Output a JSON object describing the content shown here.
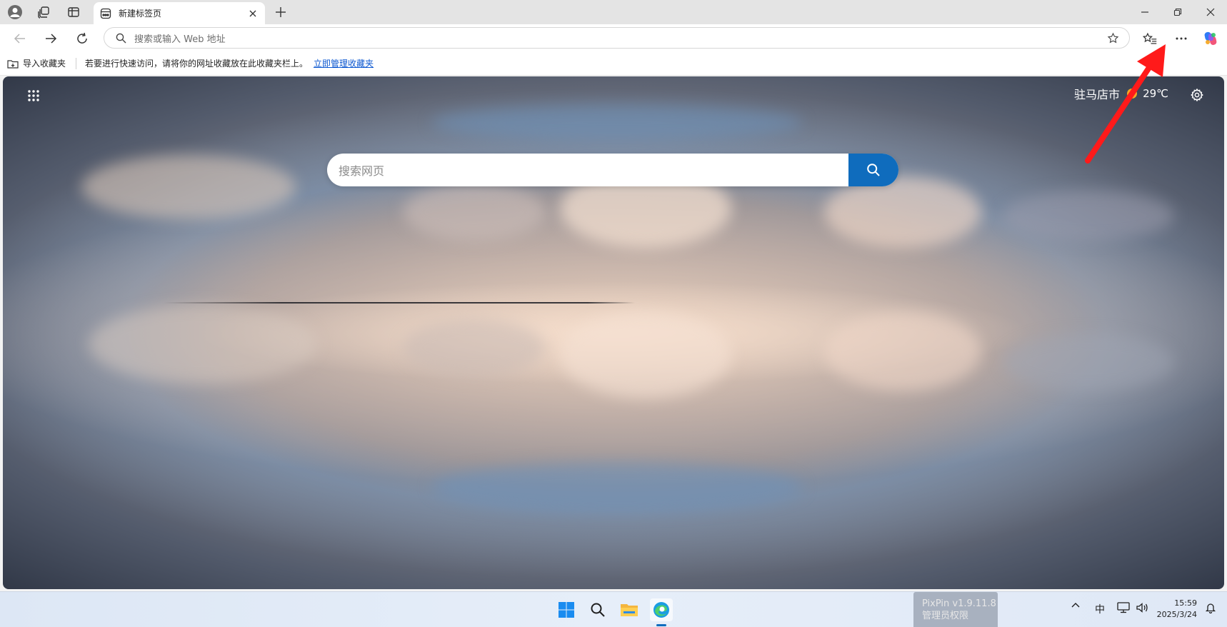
{
  "tabbar": {
    "active_tab_title": "新建标签页",
    "icons": [
      "profile-icon",
      "collections-icon",
      "vertical-tabs-icon",
      "close-icon",
      "plus-icon",
      "minimize-icon",
      "restore-icon",
      "window-close-icon"
    ]
  },
  "navbar": {
    "address_placeholder": "搜索或输入 Web 地址",
    "icons": [
      "back-icon",
      "forward-icon",
      "refresh-icon",
      "search-icon",
      "star-icon",
      "favorites-icon",
      "more-icon",
      "copilot-icon"
    ]
  },
  "favbar": {
    "import_label": "导入收藏夹",
    "hint": "若要进行快速访问，请将你的网址收藏放在此收藏夹栏上。",
    "manage_link": "立即管理收藏夹"
  },
  "newtab": {
    "weather_city": "驻马店市",
    "weather_temp": "29℃",
    "search_placeholder": "搜索网页"
  },
  "taskbar": {
    "overlay_line1": "PixPin v1.9.11.8",
    "overlay_line2": "管理员权限",
    "ime": "中",
    "time": "15:59",
    "date": "2025/3/24"
  },
  "colors": {
    "accent": "#0f6cbd",
    "annotation_arrow": "#ff1a1a"
  }
}
